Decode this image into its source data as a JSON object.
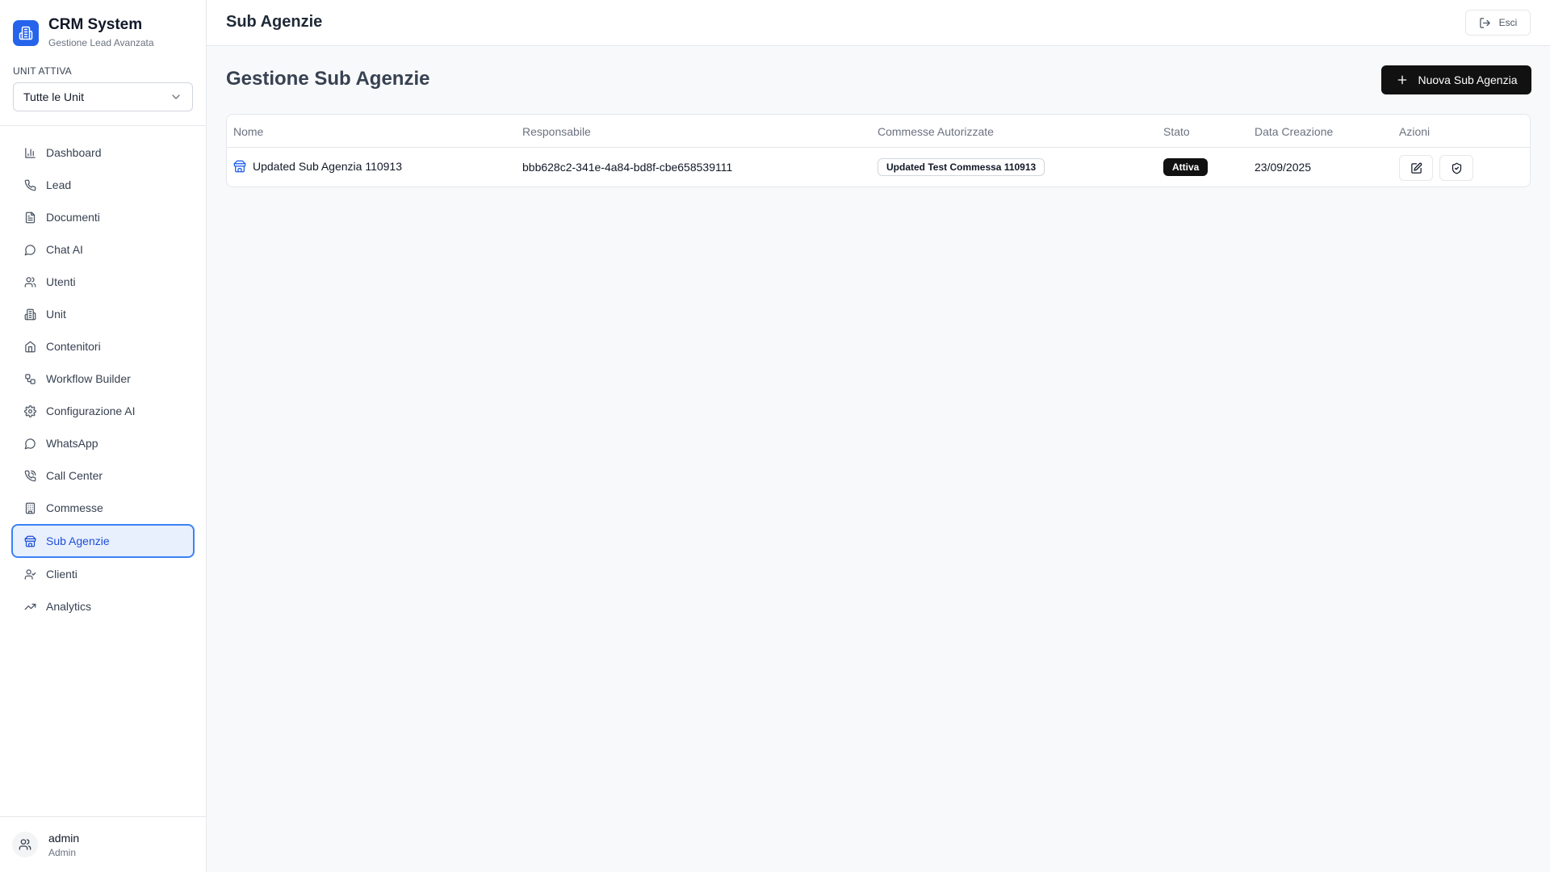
{
  "brand": {
    "title": "CRM System",
    "subtitle": "Gestione Lead Avanzata",
    "logo_icon": "building-icon",
    "accent": "#2563eb"
  },
  "unit_selector": {
    "label": "UNIT ATTIVA",
    "value": "Tutte le Unit"
  },
  "nav": [
    {
      "label": "Dashboard",
      "icon": "bar-chart-icon"
    },
    {
      "label": "Lead",
      "icon": "phone-icon"
    },
    {
      "label": "Documenti",
      "icon": "file-text-icon"
    },
    {
      "label": "Chat AI",
      "icon": "message-circle-icon"
    },
    {
      "label": "Utenti",
      "icon": "users-icon"
    },
    {
      "label": "Unit",
      "icon": "building-icon"
    },
    {
      "label": "Contenitori",
      "icon": "home-icon"
    },
    {
      "label": "Workflow Builder",
      "icon": "workflow-icon"
    },
    {
      "label": "Configurazione AI",
      "icon": "gear-icon"
    },
    {
      "label": "WhatsApp",
      "icon": "message-circle-icon"
    },
    {
      "label": "Call Center",
      "icon": "phone-call-icon"
    },
    {
      "label": "Commesse",
      "icon": "building-2-icon"
    },
    {
      "label": "Sub Agenzie",
      "icon": "store-icon",
      "active": true
    },
    {
      "label": "Clienti",
      "icon": "user-check-icon"
    },
    {
      "label": "Analytics",
      "icon": "trending-up-icon"
    }
  ],
  "user": {
    "name": "admin",
    "role": "Admin"
  },
  "header": {
    "title": "Sub Agenzie",
    "logout_label": "Esci"
  },
  "main": {
    "title": "Gestione Sub Agenzie",
    "new_button_label": "Nuova Sub Agenzia",
    "table": {
      "columns": [
        "Nome",
        "Responsabile",
        "Commesse Autorizzate",
        "Stato",
        "Data Creazione",
        "Azioni"
      ],
      "rows": [
        {
          "nome": "Updated Sub Agenzia 110913",
          "responsabile": "bbb628c2-341e-4a84-bd8f-cbe658539111",
          "commesse": "Updated Test Commessa 110913",
          "stato": "Attiva",
          "data_creazione": "23/09/2025"
        }
      ]
    }
  }
}
